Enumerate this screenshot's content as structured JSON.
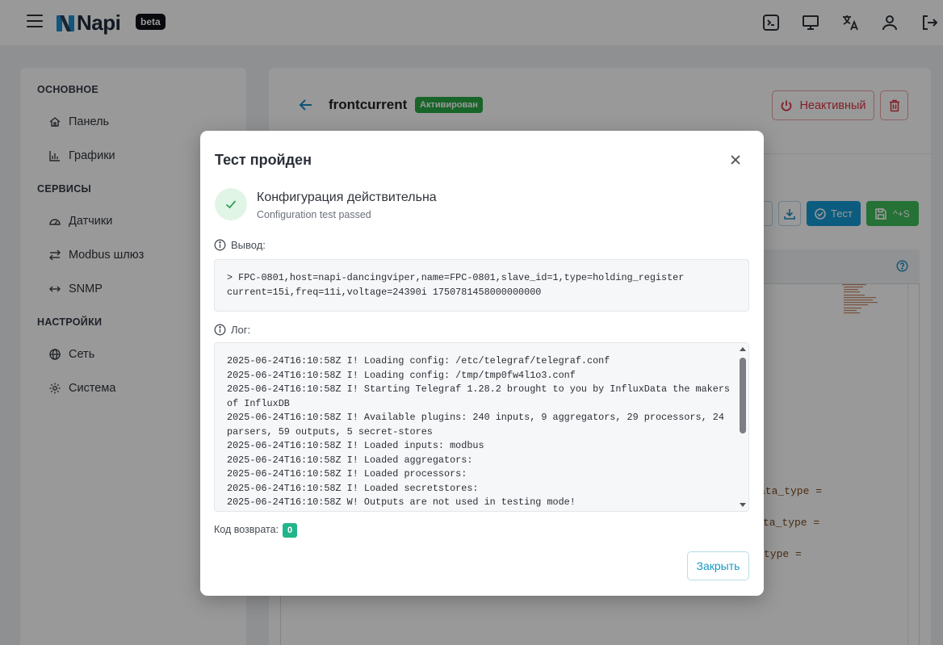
{
  "header": {
    "logo_text": "Napi",
    "beta_label": "beta",
    "icons": [
      "terminal-icon",
      "monitor-icon",
      "translate-icon",
      "user-icon",
      "logout-icon"
    ]
  },
  "sidebar": {
    "sections": [
      {
        "title": "ОСНОВНОЕ",
        "items": [
          {
            "label": "Панель",
            "icon": "home-icon"
          },
          {
            "label": "Графики",
            "icon": "chart-icon"
          }
        ]
      },
      {
        "title": "СЕРВИСЫ",
        "items": [
          {
            "label": "Датчики",
            "icon": "gauge-icon"
          },
          {
            "label": "Modbus шлюз",
            "icon": "exchange-icon"
          },
          {
            "label": "SNMP",
            "icon": "arrows-h-icon"
          }
        ]
      },
      {
        "title": "НАСТРОЙКИ",
        "items": [
          {
            "label": "Сеть",
            "icon": "globe-icon"
          },
          {
            "label": "Система",
            "icon": "gear-icon"
          }
        ]
      }
    ]
  },
  "main": {
    "title": "frontcurrent",
    "status": "Активирован",
    "inactive_button": "Неактивный",
    "test_button": "Тест",
    "save_button": "^+S",
    "code_fragments": [
      "ata_type =",
      "ta_type =",
      "type ="
    ]
  },
  "modal": {
    "title": "Тест пройден",
    "headline": "Конфигурация действительна",
    "subtitle": "Configuration test passed",
    "output_label": "Вывод:",
    "output_lines": [
      "> FPC-0801,host=napi-dancingviper,name=FPC-0801,slave_id=1,type=holding_register",
      "current=15i,freq=11i,voltage=24390i 1750781458000000000"
    ],
    "log_label": "Лог:",
    "log_lines": [
      "2025-06-24T16:10:58Z I! Loading config: /etc/telegraf/telegraf.conf",
      "2025-06-24T16:10:58Z I! Loading config: /tmp/tmp0fw4l1o3.conf",
      "2025-06-24T16:10:58Z I! Starting Telegraf 1.28.2 brought to you by InfluxData the makers of InfluxDB",
      "2025-06-24T16:10:58Z I! Available plugins: 240 inputs, 9 aggregators, 29 processors, 24 parsers, 59 outputs, 5 secret-stores",
      "2025-06-24T16:10:58Z I! Loaded inputs: modbus",
      "2025-06-24T16:10:58Z I! Loaded aggregators:",
      "2025-06-24T16:10:58Z I! Loaded processors:",
      "2025-06-24T16:10:58Z I! Loaded secretstores:",
      "2025-06-24T16:10:58Z W! Outputs are not used in testing mode!"
    ],
    "return_code_label": "Код возврата:",
    "return_code": "0",
    "close_button": "Закрыть"
  },
  "colors": {
    "accent": "#1599d6",
    "success": "#28a745",
    "danger": "#dc3545",
    "return_code": "#20b58a"
  }
}
